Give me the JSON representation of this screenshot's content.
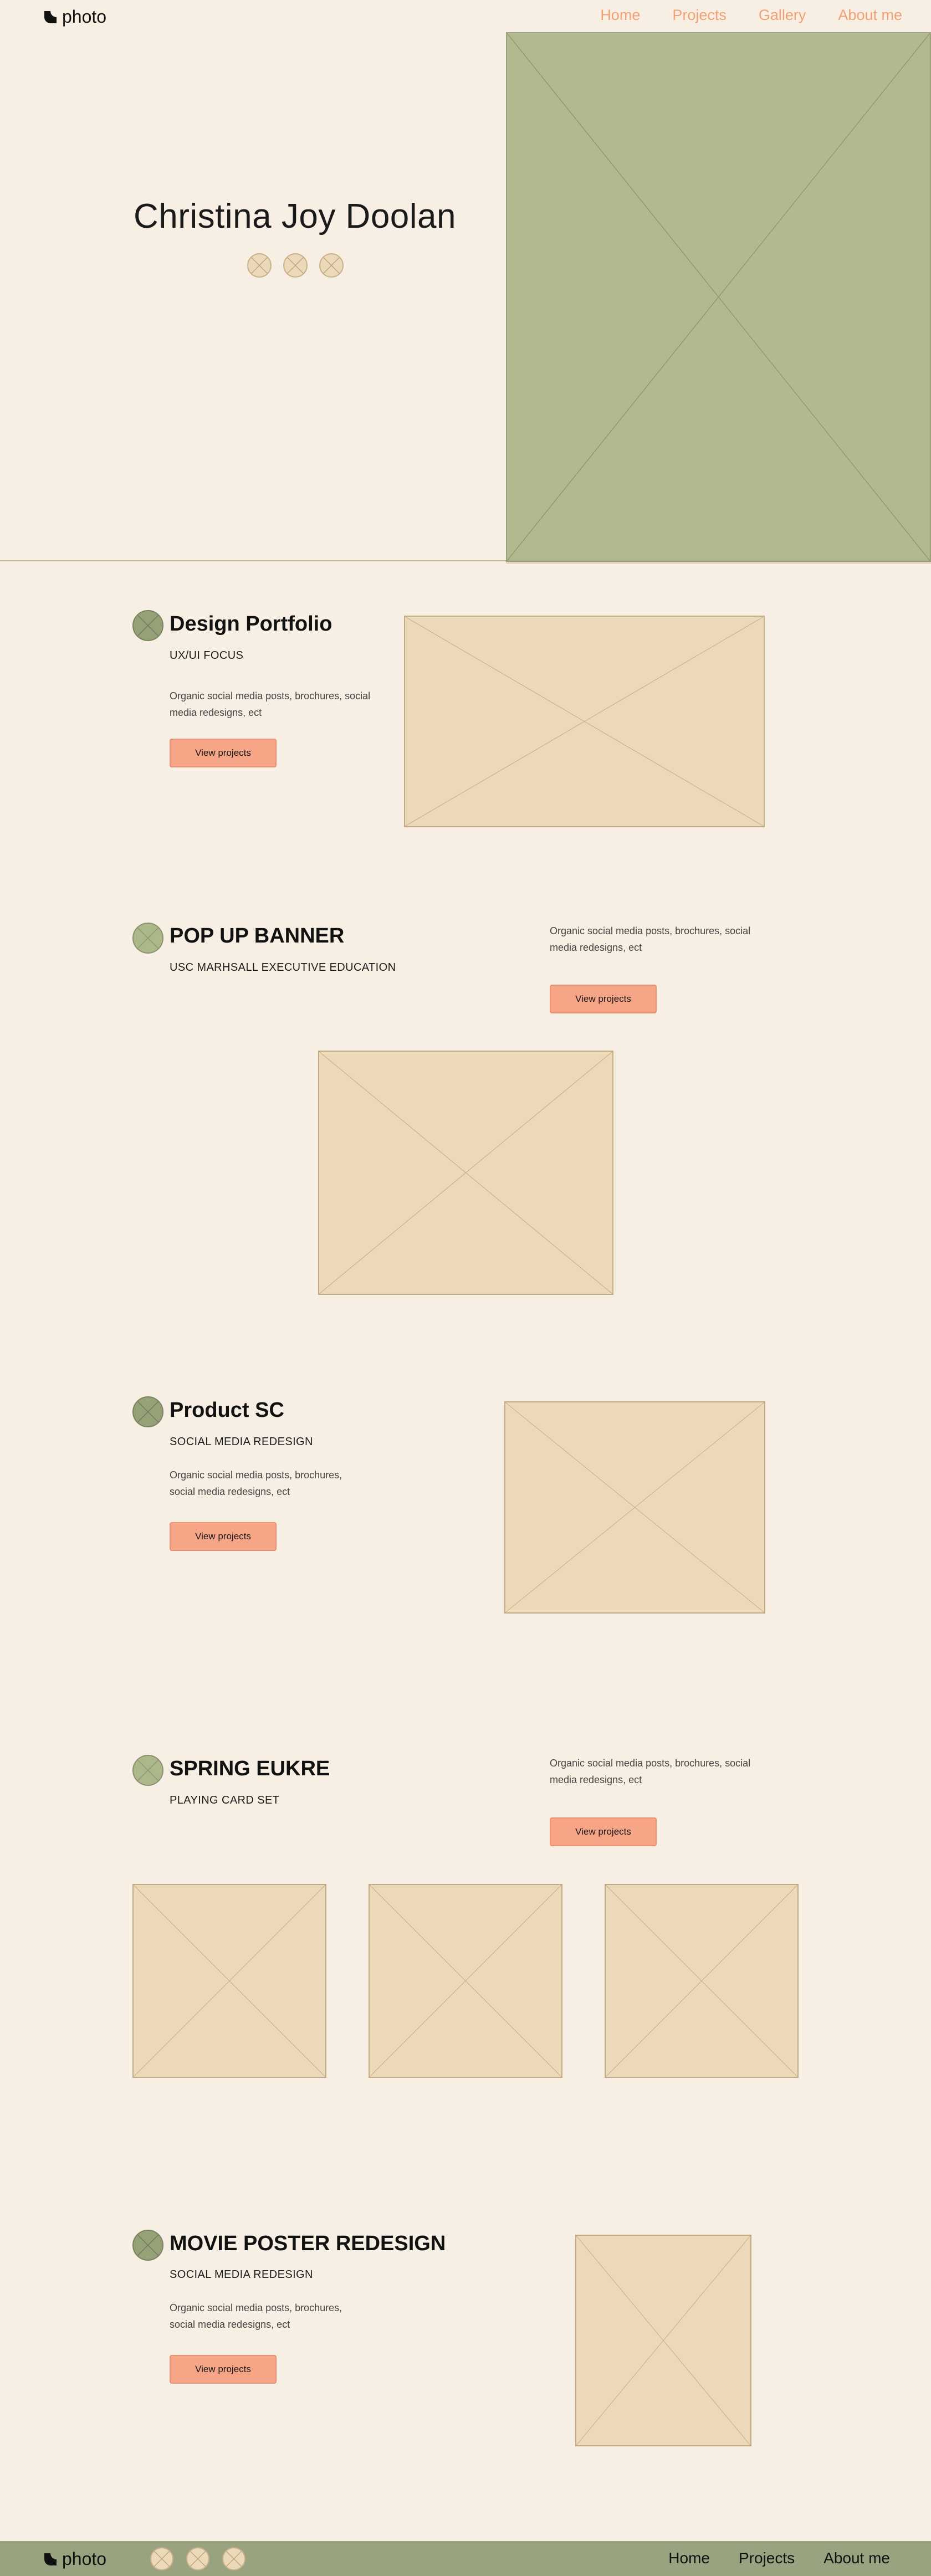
{
  "header": {
    "logo_text": "photo",
    "nav": [
      "Home",
      "Projects",
      "Gallery",
      "About me"
    ]
  },
  "hero": {
    "name": "Christina Joy Doolan",
    "social_icons": [
      "social-icon-1",
      "social-icon-2",
      "social-icon-3"
    ]
  },
  "sections": [
    {
      "title": "Design Portfolio",
      "subtitle": "UX/UI FOCUS",
      "description": "Organic social media posts, brochures, social media redesigns, ect",
      "button": "View projects"
    },
    {
      "title": "POP UP BANNER",
      "subtitle": "USC MARHSALL EXECUTIVE EDUCATION",
      "description": "Organic social media posts, brochures, social media redesigns, ect",
      "button": "View projects"
    },
    {
      "title": "Product SC",
      "subtitle": "SOCIAL MEDIA REDESIGN",
      "description": "Organic social media posts, brochures, social media redesigns, ect",
      "button": "View projects"
    },
    {
      "title": "SPRING EUKRE",
      "subtitle": "PLAYING CARD SET",
      "description": "Organic social media posts, brochures, social media redesigns, ect",
      "button": "View projects"
    },
    {
      "title": "MOVIE POSTER REDESIGN",
      "subtitle": "SOCIAL MEDIA REDESIGN",
      "description": "Organic social media posts, brochures, social media redesigns, ect",
      "button": "View projects"
    }
  ],
  "footer": {
    "logo_text": "photo",
    "nav": [
      "Home",
      "Projects",
      "About me"
    ]
  },
  "colors": {
    "background": "#f7efe3",
    "accent": "#f2a074",
    "button": "#f6a687",
    "placeholder": "#ebd9b9",
    "hero_image": "#b0b990",
    "footer": "#9aa380"
  }
}
